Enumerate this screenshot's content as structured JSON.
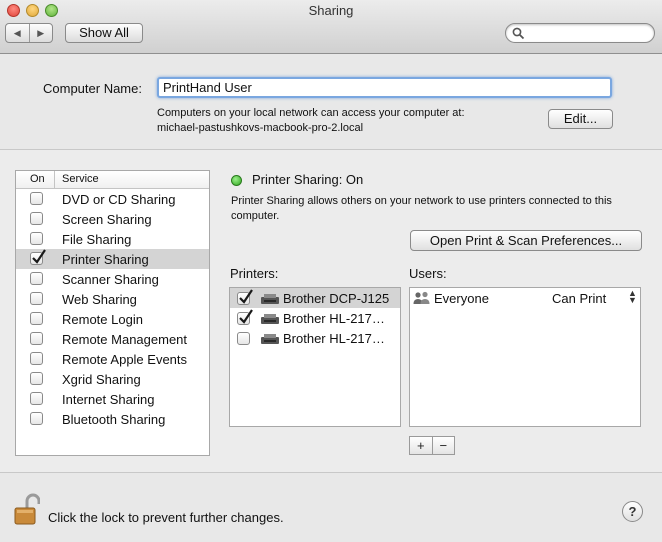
{
  "window": {
    "title": "Sharing",
    "nav_back": "◀",
    "nav_forward": "▶",
    "show_all_label": "Show All",
    "search_placeholder": ""
  },
  "computer": {
    "name_label": "Computer Name:",
    "name_value": "PrintHand User",
    "info_line1": "Computers on your local network can access your computer at:",
    "info_line2": "michael-pastushkovs-macbook-pro-2.local",
    "edit_label": "Edit..."
  },
  "services": {
    "header_on": "On",
    "header_service": "Service",
    "items": [
      {
        "label": "DVD or CD Sharing",
        "on": false,
        "selected": false
      },
      {
        "label": "Screen Sharing",
        "on": false,
        "selected": false
      },
      {
        "label": "File Sharing",
        "on": false,
        "selected": false
      },
      {
        "label": "Printer Sharing",
        "on": true,
        "selected": true
      },
      {
        "label": "Scanner Sharing",
        "on": false,
        "selected": false
      },
      {
        "label": "Web Sharing",
        "on": false,
        "selected": false
      },
      {
        "label": "Remote Login",
        "on": false,
        "selected": false
      },
      {
        "label": "Remote Management",
        "on": false,
        "selected": false
      },
      {
        "label": "Remote Apple Events",
        "on": false,
        "selected": false
      },
      {
        "label": "Xgrid Sharing",
        "on": false,
        "selected": false
      },
      {
        "label": "Internet Sharing",
        "on": false,
        "selected": false
      },
      {
        "label": "Bluetooth Sharing",
        "on": false,
        "selected": false
      }
    ]
  },
  "printer_sharing": {
    "status": "Printer Sharing: On",
    "status_color": "#2fa71e",
    "description": "Printer Sharing allows others on your network to use printers connected to this computer.",
    "open_prefs_label": "Open Print & Scan Preferences...",
    "printers_label": "Printers:",
    "users_label": "Users:",
    "printers": [
      {
        "name": "Brother DCP-J125",
        "checked": true,
        "selected": true
      },
      {
        "name": "Brother HL-217…",
        "checked": true,
        "selected": false
      },
      {
        "name": "Brother HL-217…",
        "checked": false,
        "selected": false
      }
    ],
    "users": [
      {
        "name": "Everyone",
        "permission": "Can Print",
        "icon": "group-icon"
      }
    ],
    "add_label": "+",
    "remove_label": "−"
  },
  "bottom": {
    "lock_text": "Click the lock to prevent further changes.",
    "help_label": "?"
  }
}
